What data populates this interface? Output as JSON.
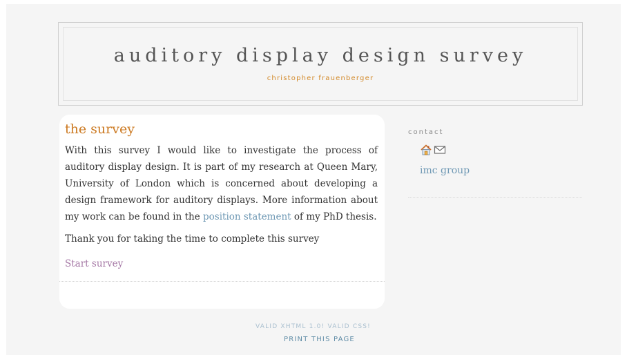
{
  "header": {
    "title": "auditory display design survey",
    "author": "christopher frauenberger"
  },
  "main": {
    "title": "the survey",
    "intro_text_before_link": "With this survey I would like to investigate the process of auditory display design. It is part of my research at Queen Mary, University of London which is concerned about developing a design framework for auditory displays. More information about my work can be found in the ",
    "position_statement_link": "position statement",
    "intro_text_after_link": " of my PhD thesis.",
    "thanks_text": "Thank you for taking the time to complete this survey",
    "start_link": "Start survey"
  },
  "sidebar": {
    "heading": "contact",
    "icons": [
      "home-icon",
      "email-icon"
    ],
    "group_link": "imc group"
  },
  "footer": {
    "valid_xhtml": "VALID XHTML 1.0!",
    "valid_css": "VALID CSS!",
    "print_link": "PRINT THIS PAGE"
  },
  "colors": {
    "accent_orange": "#cc7a22",
    "link_blue": "#6e98b4",
    "visited_link": "#a679a6",
    "background": "#f5f5f5"
  }
}
